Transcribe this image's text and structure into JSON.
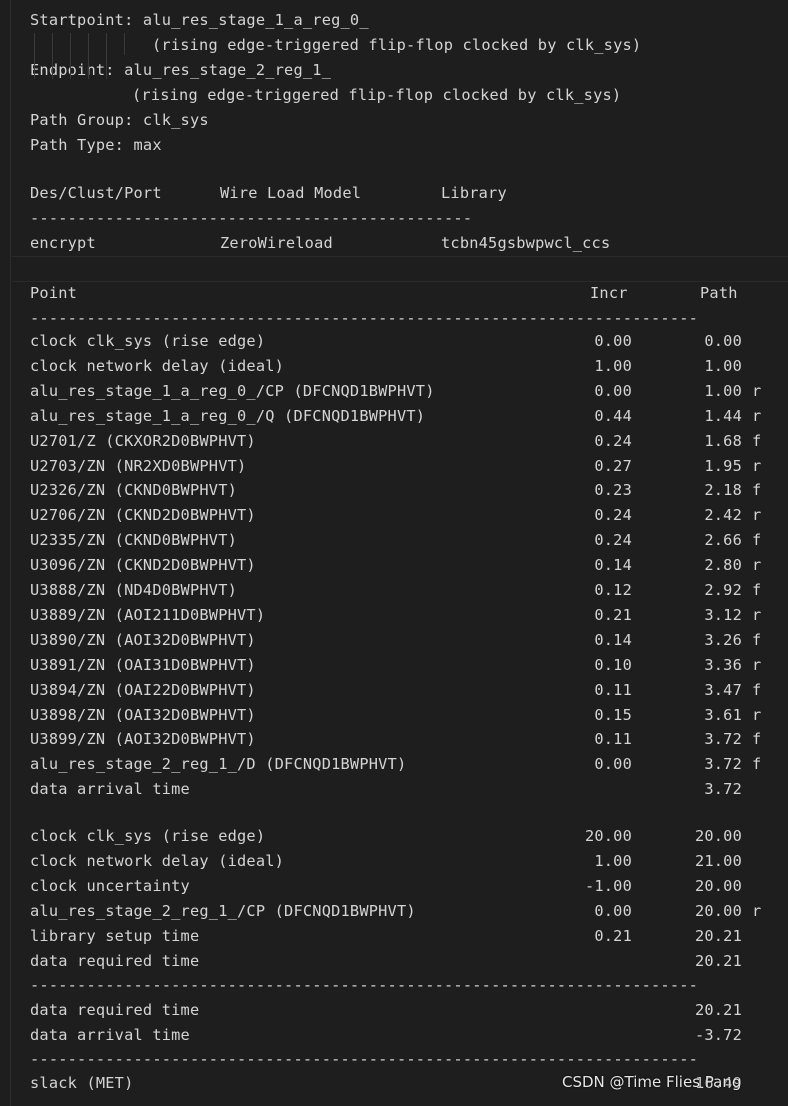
{
  "header": {
    "startpoint": "Startpoint: alu_res_stage_1_a_reg_0_",
    "startpoint_desc": "(rising edge-triggered flip-flop clocked by clk_sys)",
    "endpoint": "Endpoint: alu_res_stage_2_reg_1_",
    "endpoint_desc": "(rising edge-triggered flip-flop clocked by clk_sys)",
    "path_group": "Path Group: clk_sys",
    "path_type": "Path Type: max"
  },
  "design_table": {
    "headers": [
      "Des/Clust/Port",
      "Wire Load Model",
      "Library"
    ],
    "separator": "-----------------------------------------------",
    "row": [
      "encrypt",
      "ZeroWireload",
      "tcbn45gsbwpwcl_ccs"
    ]
  },
  "path_table": {
    "headers": [
      "Point",
      "Incr",
      "Path"
    ],
    "separator": "-----------------------------------------------------------------------",
    "arrival_rows": [
      {
        "point": "clock clk_sys (rise edge)",
        "incr": "0.00",
        "path": "0.00",
        "edge": ""
      },
      {
        "point": "clock network delay (ideal)",
        "incr": "1.00",
        "path": "1.00",
        "edge": ""
      },
      {
        "point": "alu_res_stage_1_a_reg_0_/CP (DFCNQD1BWPHVT)",
        "incr": "0.00",
        "path": "1.00",
        "edge": "r"
      },
      {
        "point": "alu_res_stage_1_a_reg_0_/Q (DFCNQD1BWPHVT)",
        "incr": "0.44",
        "path": "1.44",
        "edge": "r"
      },
      {
        "point": "U2701/Z (CKXOR2D0BWPHVT)",
        "incr": "0.24",
        "path": "1.68",
        "edge": "f"
      },
      {
        "point": "U2703/ZN (NR2XD0BWPHVT)",
        "incr": "0.27",
        "path": "1.95",
        "edge": "r"
      },
      {
        "point": "U2326/ZN (CKND0BWPHVT)",
        "incr": "0.23",
        "path": "2.18",
        "edge": "f"
      },
      {
        "point": "U2706/ZN (CKND2D0BWPHVT)",
        "incr": "0.24",
        "path": "2.42",
        "edge": "r"
      },
      {
        "point": "U2335/ZN (CKND0BWPHVT)",
        "incr": "0.24",
        "path": "2.66",
        "edge": "f"
      },
      {
        "point": "U3096/ZN (CKND2D0BWPHVT)",
        "incr": "0.14",
        "path": "2.80",
        "edge": "r"
      },
      {
        "point": "U3888/ZN (ND4D0BWPHVT)",
        "incr": "0.12",
        "path": "2.92",
        "edge": "f"
      },
      {
        "point": "U3889/ZN (AOI211D0BWPHVT)",
        "incr": "0.21",
        "path": "3.12",
        "edge": "r"
      },
      {
        "point": "U3890/ZN (AOI32D0BWPHVT)",
        "incr": "0.14",
        "path": "3.26",
        "edge": "f"
      },
      {
        "point": "U3891/ZN (OAI31D0BWPHVT)",
        "incr": "0.10",
        "path": "3.36",
        "edge": "r"
      },
      {
        "point": "U3894/ZN (OAI22D0BWPHVT)",
        "incr": "0.11",
        "path": "3.47",
        "edge": "f"
      },
      {
        "point": "U3898/ZN (OAI32D0BWPHVT)",
        "incr": "0.15",
        "path": "3.61",
        "edge": "r"
      },
      {
        "point": "U3899/ZN (AOI32D0BWPHVT)",
        "incr": "0.11",
        "path": "3.72",
        "edge": "f"
      },
      {
        "point": "alu_res_stage_2_reg_1_/D (DFCNQD1BWPHVT)",
        "incr": "0.00",
        "path": "3.72",
        "edge": "f"
      },
      {
        "point": "data arrival time",
        "incr": "",
        "path": "3.72",
        "edge": ""
      }
    ],
    "required_rows": [
      {
        "point": "clock clk_sys (rise edge)",
        "incr": "20.00",
        "path": "20.00",
        "edge": ""
      },
      {
        "point": "clock network delay (ideal)",
        "incr": "1.00",
        "path": "21.00",
        "edge": ""
      },
      {
        "point": "clock uncertainty",
        "incr": "-1.00",
        "path": "20.00",
        "edge": ""
      },
      {
        "point": "alu_res_stage_2_reg_1_/CP (DFCNQD1BWPHVT)",
        "incr": "0.00",
        "path": "20.00",
        "edge": "r"
      },
      {
        "point": "library setup time",
        "incr": "0.21",
        "path": "20.21",
        "edge": ""
      },
      {
        "point": "data required time",
        "incr": "",
        "path": "20.21",
        "edge": ""
      }
    ],
    "summary_rows": [
      {
        "point": "data required time",
        "incr": "",
        "path": "20.21",
        "edge": ""
      },
      {
        "point": "data arrival time",
        "incr": "",
        "path": "-3.72",
        "edge": ""
      }
    ],
    "slack": {
      "point": "slack (MET)",
      "path": "16.49"
    }
  },
  "watermark": "CSDN @Time Flies Pang"
}
